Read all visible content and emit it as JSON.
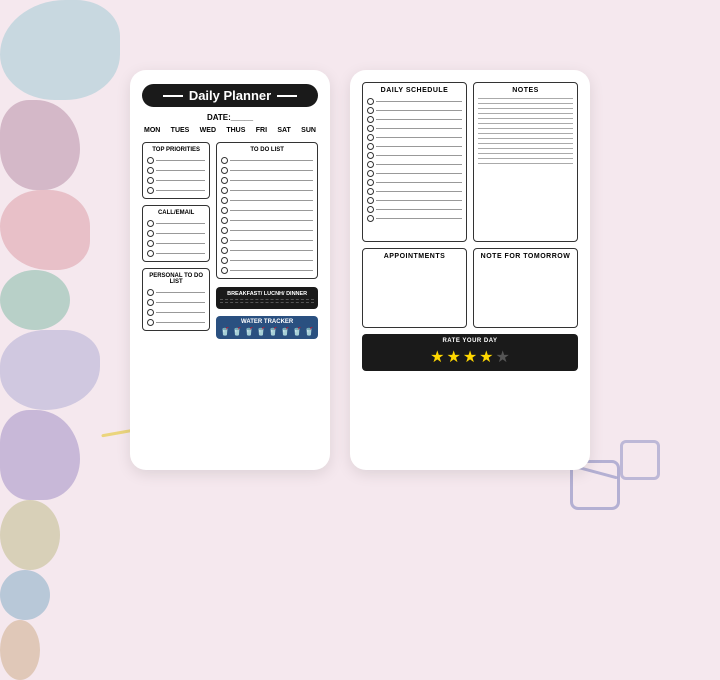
{
  "background": {
    "color": "#f5e8ee"
  },
  "left_card": {
    "title": "Daily Planner",
    "date_label": "DATE:",
    "days": [
      "MON",
      "TUES",
      "WED",
      "THUS",
      "FRI",
      "SAT",
      "SUN"
    ],
    "sections": {
      "top_priorities": {
        "title": "TOP PRIORITIES",
        "checkbox_count": 4
      },
      "call_email": {
        "title": "CALL/EMAIL",
        "checkbox_count": 4
      },
      "personal_todo": {
        "title": "PERSONAL TO DO LIST",
        "checkbox_count": 4
      },
      "todo_list": {
        "title": "TO DO LIST",
        "checkbox_count": 12
      },
      "breakfast": {
        "title": "BREAKFAST/ LUCNH/ DINNER"
      },
      "water_tracker": {
        "title": "WATER TRACKER",
        "icon": "🥤",
        "count": 8
      }
    }
  },
  "right_card": {
    "sections": {
      "daily_schedule": {
        "title": "DAILY SCHEDULE",
        "line_count": 14
      },
      "notes": {
        "title": "NOTES",
        "line_count": 14
      },
      "appointments": {
        "title": "APPOINTMENTS"
      },
      "note_tomorrow": {
        "title": "NOTE FOR TOMORROW"
      },
      "rate_day": {
        "title": "RATE YOUR DAY",
        "stars": 4,
        "max_stars": 5
      }
    }
  }
}
